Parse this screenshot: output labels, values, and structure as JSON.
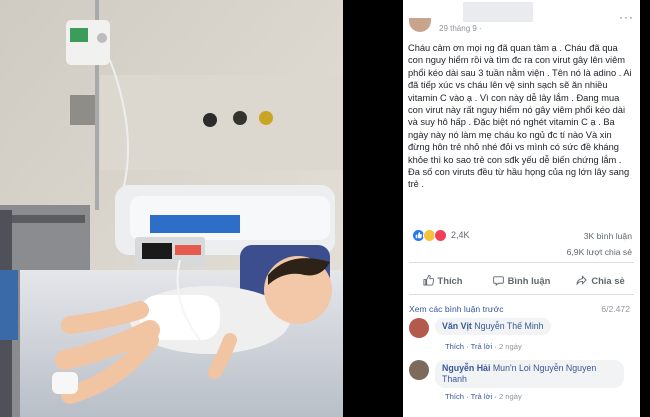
{
  "post": {
    "date": "29 tháng 9 ·",
    "more_label": "···",
    "text": "Cháu cảm ơn mọi ng đã quan tâm ạ . Cháu đã qua con nguy hiểm rồi và tìm đc ra con virut gây lên viêm phổi kéo dài sau 3 tuần nằm viện . Tên nó là adino . Ai đã tiếp xúc vs cháu lên vệ sinh sạch sẽ ăn nhiều vitamin C vào ạ . Vì con này dễ lây lắm . Đang mua con virut này rất nguy hiểm nó gây viêm phổi kéo dài và suy hô hấp . Đặc biệt nó nghét vitamin C ạ . Ba ngày này nó làm mẹ cháu ko ngủ đc tí nào Và xin đừng hôn trẻ nhỏ nhé đỏi vs mình có sức đề kháng khỏe thì ko sao trẻ con sđk yếu dễ biến chứng lắm . Đa số con viruts đều từ hầu họng của ng lớn lây sang trẻ .",
    "reaction_count": "2,4K",
    "comment_count": "3K bình luận",
    "share_count": "6,9K lượt chia sẻ"
  },
  "actions": {
    "like": "Thích",
    "comment": "Bình luận",
    "share": "Chia sẻ"
  },
  "comments_header": {
    "more": "Xem các bình luận trước",
    "page": "6/2.472"
  },
  "comments": [
    {
      "name": "Văn Vịt",
      "text": "Nguyễn Thế Minh",
      "like": "Thích",
      "reply": "Trả lời",
      "time": "2 ngày"
    },
    {
      "name": "Nguyễn Hải",
      "text": "Mun'n Loi Nguyễn Nguyen Thanh",
      "like": "Thích",
      "reply": "Trả lời",
      "time": "2 ngày"
    }
  ],
  "colors": {
    "link": "#385898",
    "accent": "#2078f4",
    "text": "#1d2129",
    "muted": "#606770"
  }
}
